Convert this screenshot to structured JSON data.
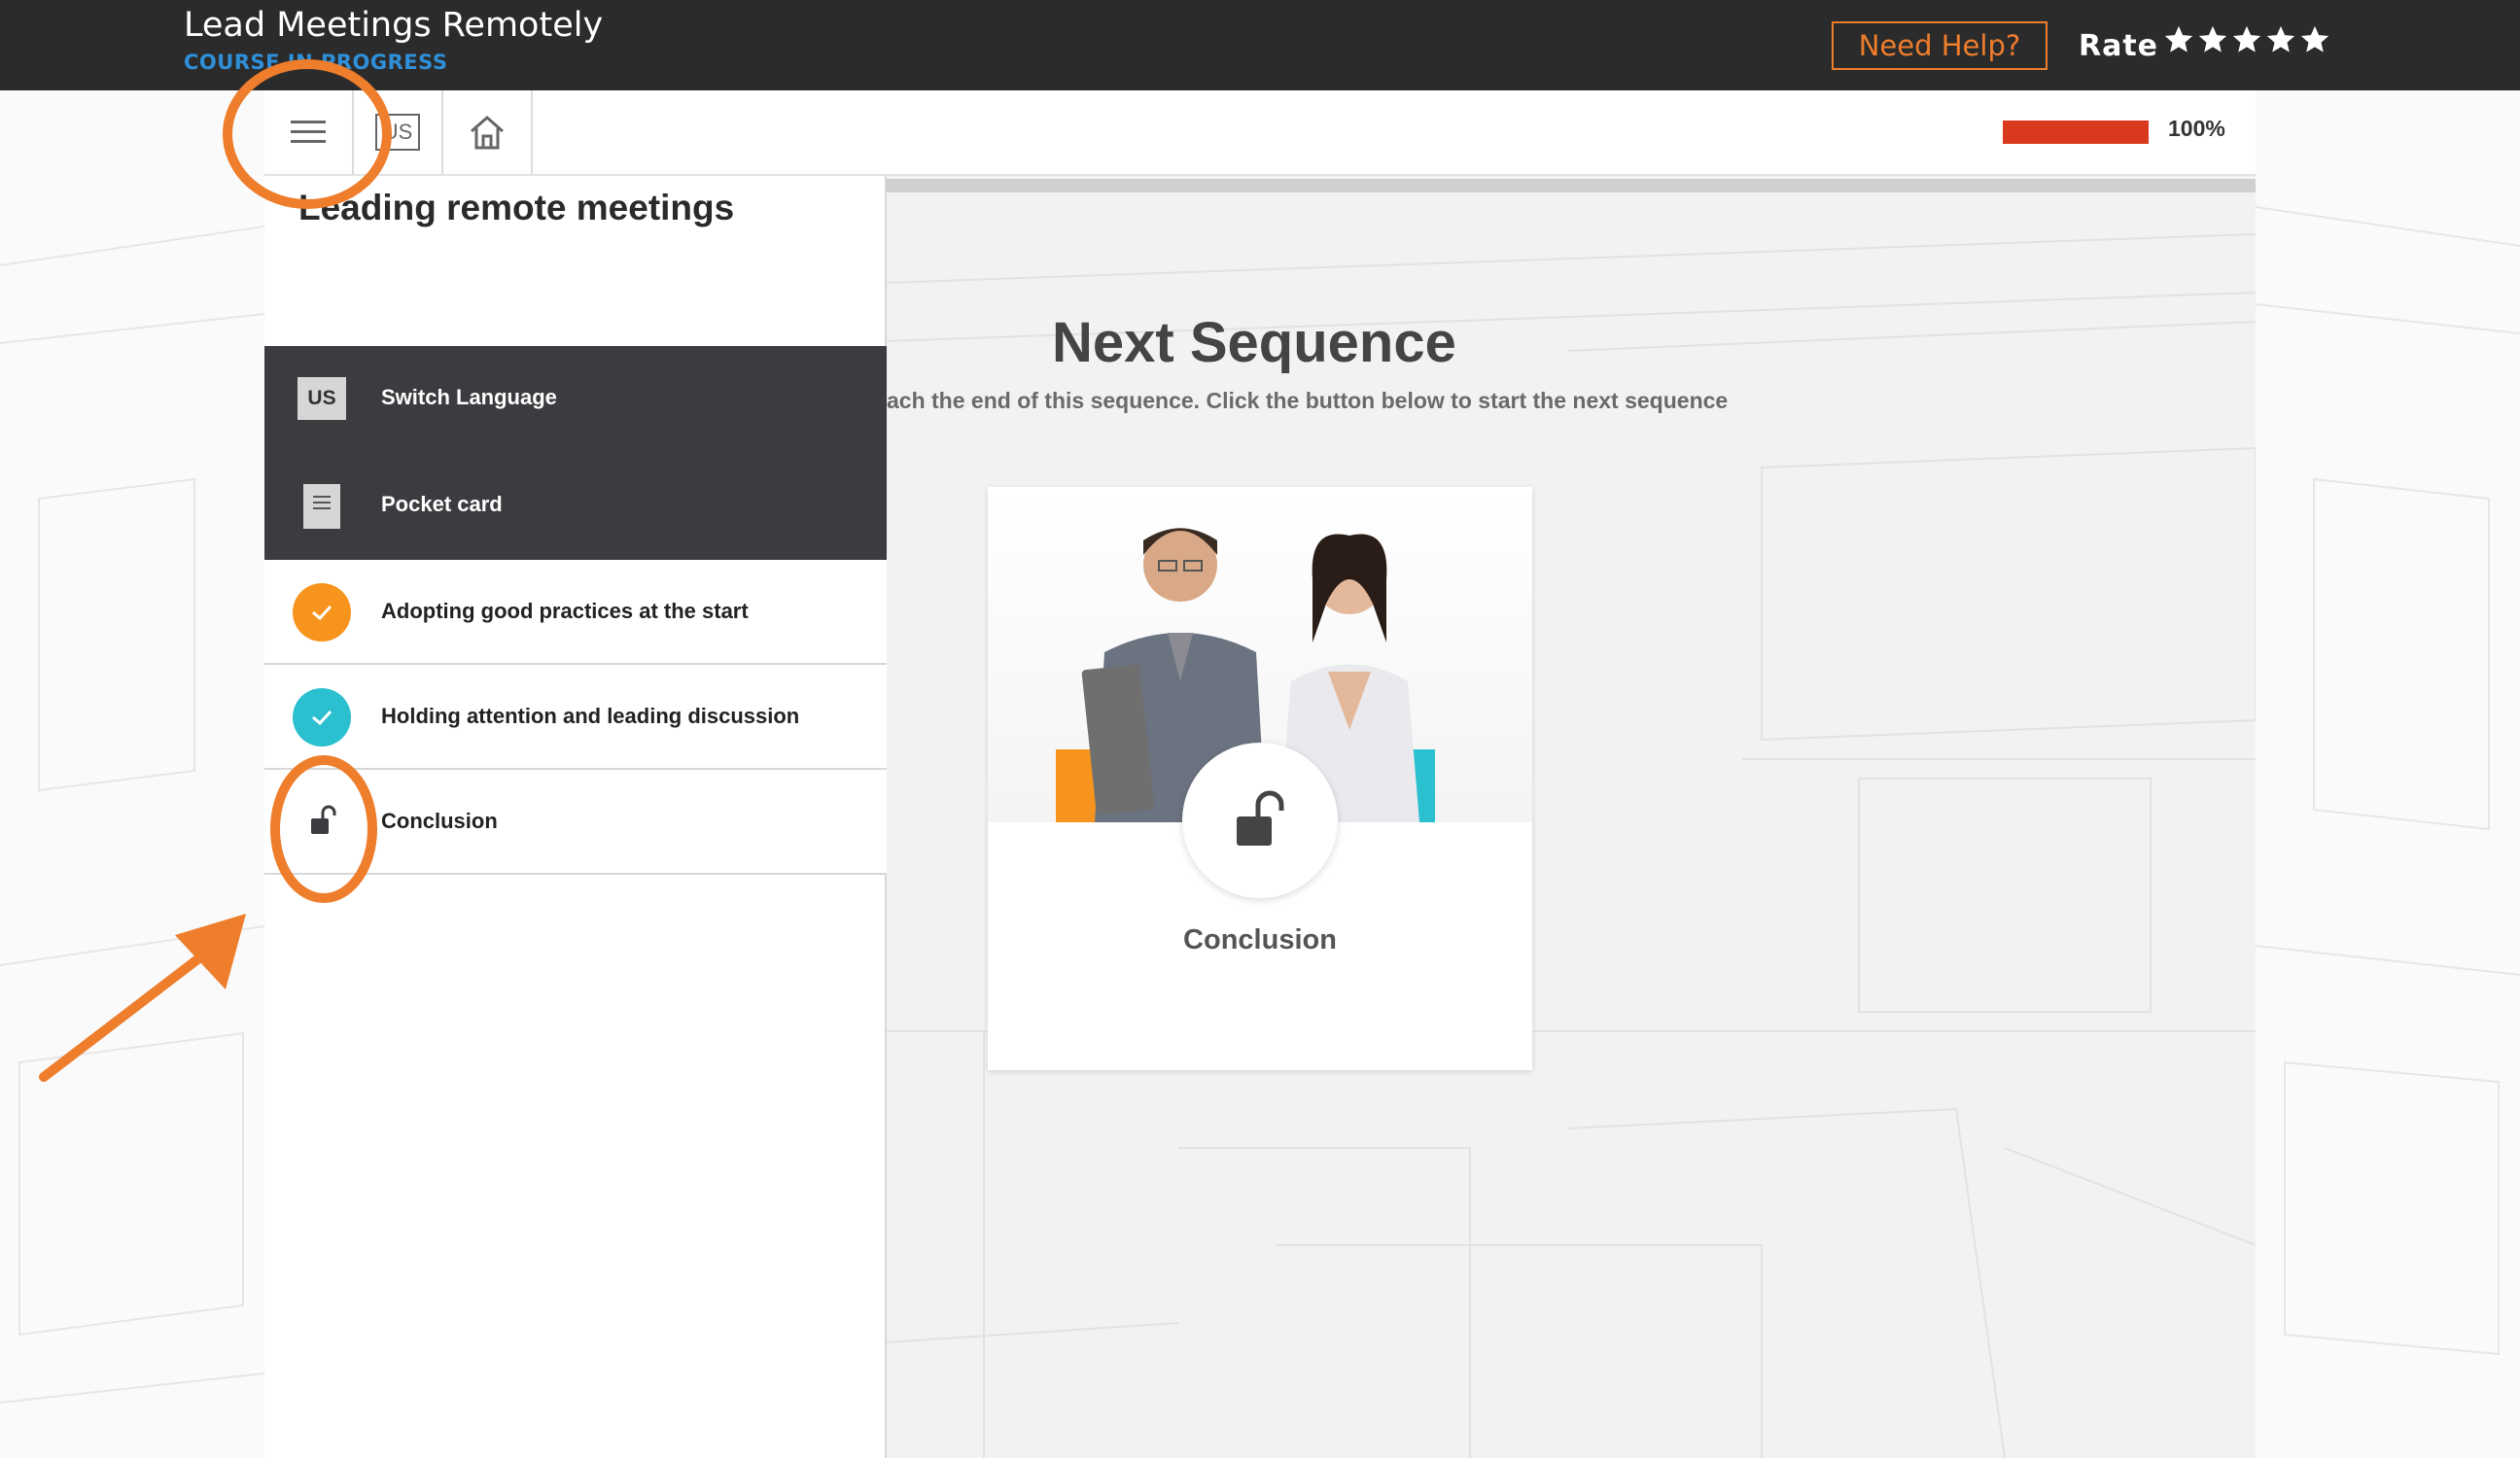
{
  "header": {
    "course_title": "Lead Meetings Remotely",
    "course_status": "COURSE IN PROGRESS",
    "help_button": "Need Help?",
    "rate_label": "Rate",
    "star_count": 5
  },
  "toolbar": {
    "menu_icon": "menu-icon",
    "language_code": "US",
    "home_icon": "home-icon",
    "progress_percent": 100,
    "progress_text": "100%"
  },
  "sidebar": {
    "title": "Leading remote meetings",
    "items": [
      {
        "label": "Switch Language",
        "icon": "US",
        "style": "dark"
      },
      {
        "label": "Pocket card",
        "icon": "document-icon",
        "style": "dark"
      },
      {
        "label": "Adopting good practices at the start",
        "icon": "check-icon",
        "color": "#f7941d"
      },
      {
        "label": "Holding attention and leading discussion",
        "icon": "check-icon",
        "color": "#2bc0cf"
      },
      {
        "label": "Conclusion",
        "icon": "unlocked-icon"
      }
    ]
  },
  "main": {
    "title": "Next Sequence",
    "subtitle": "ach the end of this sequence. Click the button below to start the next sequence",
    "card": {
      "label": "Conclusion",
      "icon": "unlocked-icon"
    }
  },
  "colors": {
    "topbar_bg": "#2b2b2b",
    "status_blue": "#2f8fd8",
    "accent_orange": "#ee7d2c",
    "progress_red": "#d9391c",
    "sidebar_dark": "#3b3c3f"
  }
}
